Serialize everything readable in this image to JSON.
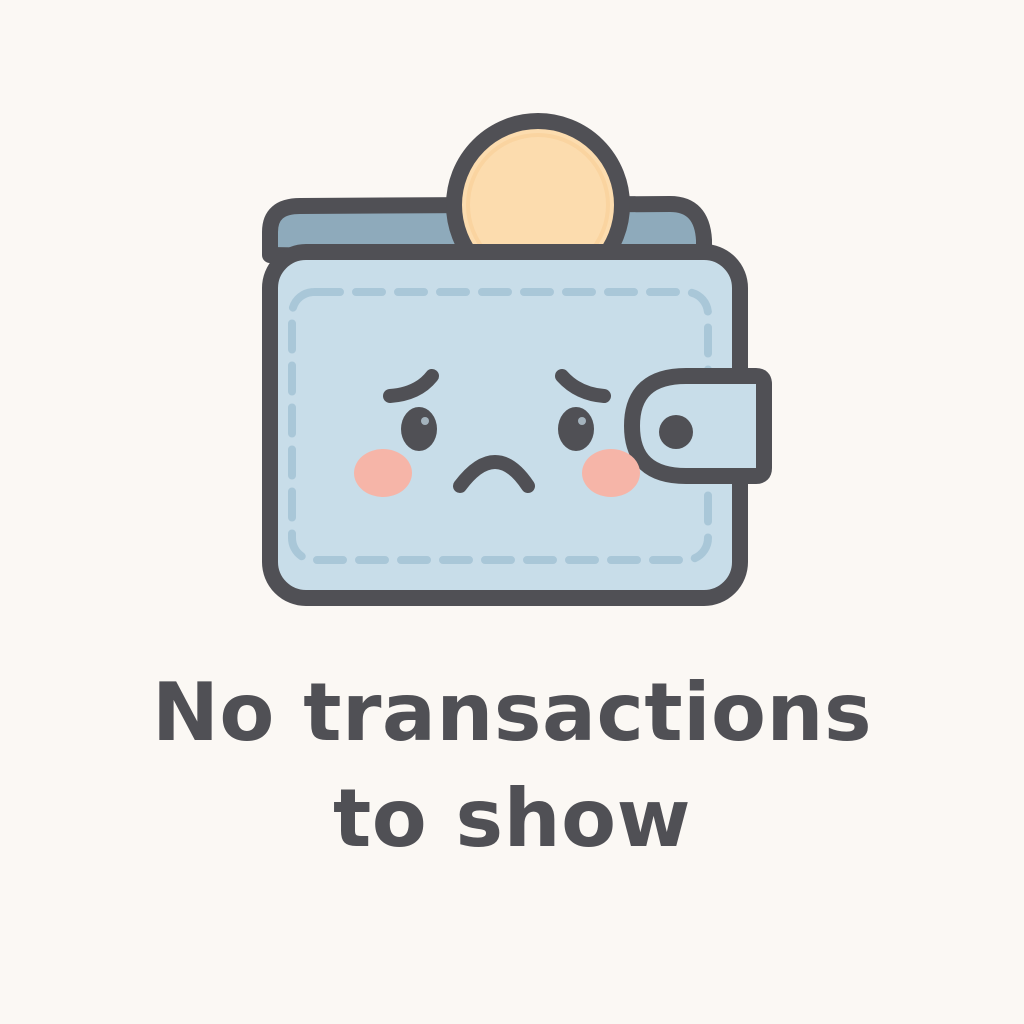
{
  "empty_state": {
    "illustration": "sad-wallet-with-coin-icon",
    "message_line_1": "No transactions",
    "message_line_2": "to show"
  },
  "colors": {
    "background": "#fbf8f4",
    "outline": "#505055",
    "wallet_body": "#c8dde9",
    "wallet_inner": "#8eaabb",
    "stitching": "#a9c7d8",
    "coin": "#fcdcae",
    "cheek": "#f6b5a8"
  }
}
